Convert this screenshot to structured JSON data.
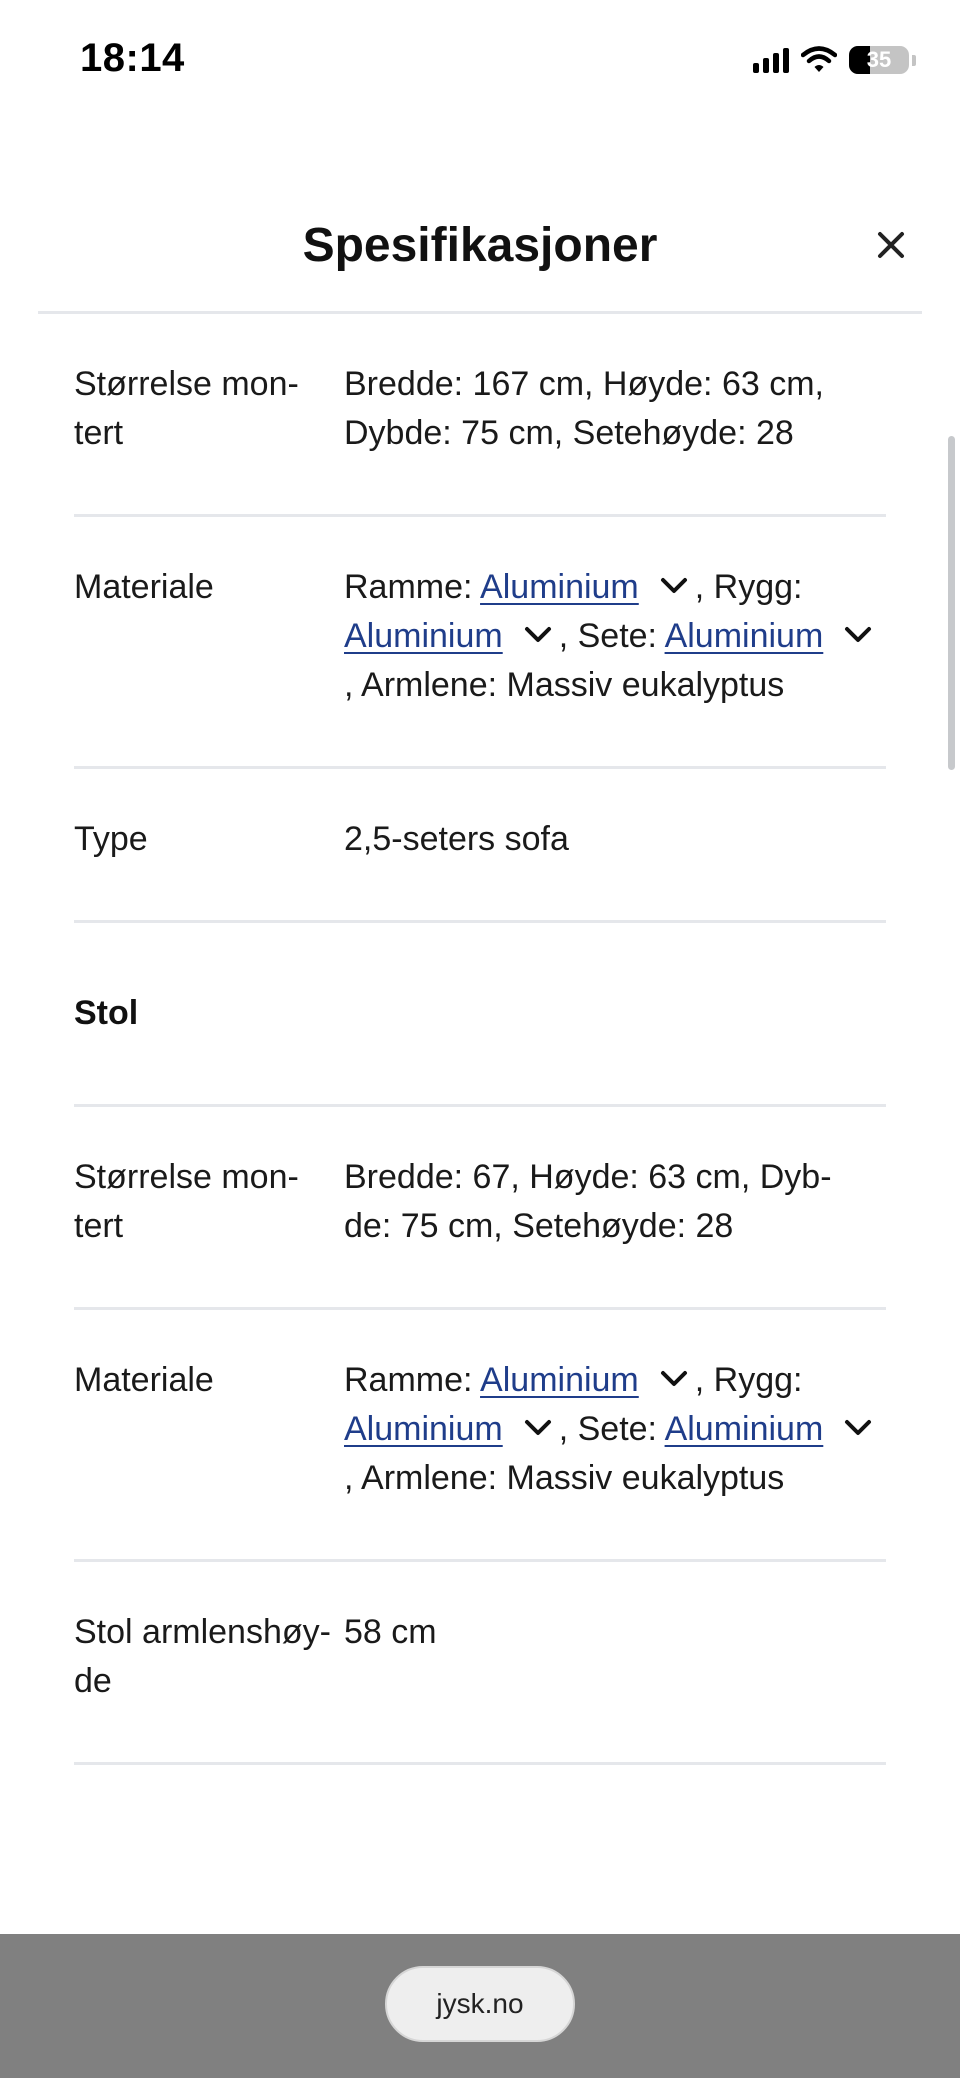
{
  "status_bar": {
    "time": "18:14",
    "battery": "35",
    "battery_level_pct": 35
  },
  "sheet": {
    "title": "Spesifikasjoner"
  },
  "rows": [
    {
      "label": "Størrelse mon-\ntert",
      "value": "Bredde: 167 cm, Høyde: 63 cm, Dybde: 75 cm, Setehøyde: 28"
    },
    {
      "label": "Materiale",
      "prefix": "Ramme:",
      "frame": "Aluminium",
      "sep_back": ", Rygg:",
      "back": "Aluminium",
      "sep_seat": ", Sete:",
      "seat": "Aluminium",
      "suffix": ", Armlene: Massiv eukalyptus"
    },
    {
      "label": "Type",
      "value": "2,5-seters sofa"
    },
    {
      "section": "Stol"
    },
    {
      "label": "Størrelse mon-\ntert",
      "value": "Bredde: 67, Høyde: 63 cm, Dyb-\nde: 75 cm, Setehøyde: 28"
    },
    {
      "label": "Materiale",
      "prefix": "Ramme:",
      "frame": "Aluminium",
      "sep_back": ", Rygg:",
      "back": "Aluminium",
      "sep_seat": ", Sete:",
      "seat": "Aluminium",
      "suffix": ", Armlene: Massiv eukalyptus"
    },
    {
      "label": "Stol armlenshøy-\nde",
      "value": "58 cm"
    }
  ],
  "browser": {
    "url": "jysk.no"
  }
}
